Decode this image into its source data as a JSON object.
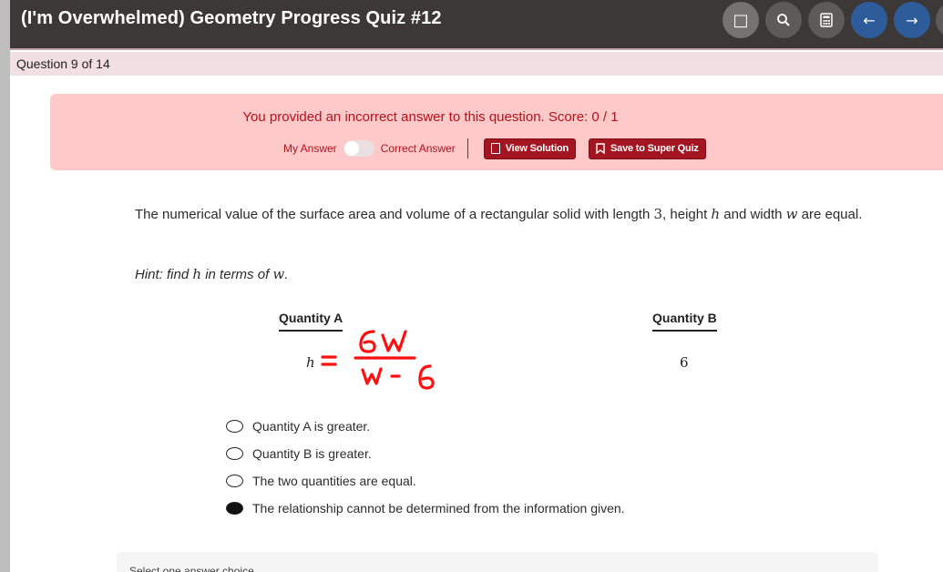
{
  "header": {
    "title": "(I'm Overwhelmed) Geometry Progress Quiz #12",
    "buttons": [
      {
        "name": "stop",
        "glyph": "□"
      },
      {
        "name": "search",
        "glyph": "⌕"
      },
      {
        "name": "calculator",
        "glyph": "▦"
      },
      {
        "name": "previous",
        "glyph": "←"
      },
      {
        "name": "next",
        "glyph": "→"
      }
    ]
  },
  "question_bar": {
    "count": "Question 9 of 14"
  },
  "feedback": {
    "message": "You provided an incorrect answer to this question. Score: 0 / 1",
    "my_answer_label": "My Answer",
    "correct_answer_label": "Correct Answer",
    "view_solution_label": "View Solution",
    "save_label": "Save to Super Quiz"
  },
  "question": {
    "text_1": "The numerical value of the surface area and volume of a rectangular solid with length ",
    "length_value": "3",
    "text_2": ", height ",
    "height_var": "h",
    "text_3": " and width ",
    "width_var": "w",
    "text_4": " are equal.",
    "hint_prefix": "Hint: find ",
    "hint_var_h": "h",
    "hint_mid": " in terms of ",
    "hint_var_w": "w",
    "hint_suffix": "."
  },
  "quantities": {
    "a_heading": "Quantity A",
    "a_value": "h",
    "b_heading": "Quantity B",
    "b_value": "6"
  },
  "annotation": {
    "equals": "=",
    "numerator": "6w",
    "denominator": "w-6",
    "color": "#ff1010"
  },
  "options": [
    {
      "label": "Quantity A is greater.",
      "selected": false
    },
    {
      "label": "Quantity B is greater.",
      "selected": false
    },
    {
      "label": "The two quantities are equal.",
      "selected": false
    },
    {
      "label": "The relationship cannot be determined from the information given.",
      "selected": true
    }
  ],
  "footer": {
    "instruction": "Select one answer choice."
  },
  "colors": {
    "header_bg": "#3d3838",
    "error_text": "#b5121b",
    "feedback_bg": "#ffc9c9",
    "button_red": "#a31621",
    "nav_blue": "#2e5c9a"
  }
}
